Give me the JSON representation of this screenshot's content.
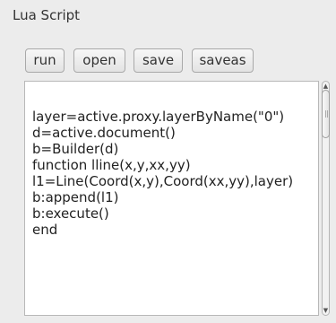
{
  "panel": {
    "title": "Lua Script"
  },
  "toolbar": {
    "run_label": "run",
    "open_label": "open",
    "save_label": "save",
    "saveas_label": "saveas"
  },
  "editor": {
    "code": "layer=active.proxy.layerByName(\"0\")\nd=active.document()\nb=Builder(d)\nfunction lline(x,y,xx,yy)\nl1=Line(Coord(x,y),Coord(xx,yy),layer)\nb:append(l1)\nb:execute()\nend"
  },
  "scrollbar": {
    "up_arrow_icon": "chevron-up-icon",
    "down_arrow_icon": "chevron-down-icon",
    "up_glyph": "▲",
    "down_glyph": "▼"
  }
}
